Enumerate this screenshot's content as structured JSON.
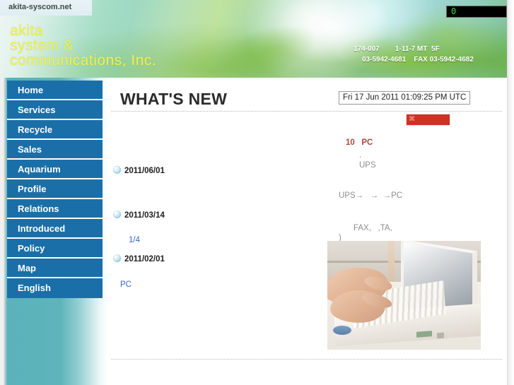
{
  "header": {
    "site_url": "akita-syscom.net",
    "logo_line1": "akita",
    "logo_line2": "system &",
    "logo_line3": "communications, Inc.",
    "counter_value": "0",
    "contact_line1": "174-007        1-11-7 MT  5F",
    "contact_line2": "03-5942-4681    FAX 03-5942-4682",
    "counter_icon": "hit-counter"
  },
  "sidebar": {
    "items": [
      {
        "label": "Home"
      },
      {
        "label": "Services"
      },
      {
        "label": "Recycle"
      },
      {
        "label": "Sales"
      },
      {
        "label": "Aquarium"
      },
      {
        "label": "Profile"
      },
      {
        "label": "Relations"
      },
      {
        "label": "Introduced"
      },
      {
        "label": "Policy"
      },
      {
        "label": "Map"
      },
      {
        "label": "English"
      }
    ]
  },
  "main": {
    "page_title": "WHAT'S NEW",
    "datetime": "Fri 17 Jun 2011 01:09:25 PM UTC",
    "banner": {
      "glyph": "⌘",
      "color": "#cf3125"
    },
    "news": [
      {
        "date": "2011/06/01"
      },
      {
        "date": "2011/03/14"
      },
      {
        "date": "2011/02/01"
      }
    ],
    "news_links": [
      {
        "label": "1/4"
      },
      {
        "label": "PC"
      }
    ],
    "right_column": {
      "heading": "10   PC",
      "line1": ".",
      "line2": "UPS",
      "line3": "UPS→   →  →PC",
      "line4": "FAX,   ,TA,",
      "line5": ")"
    },
    "photo_alt": "hands-typing-on-laptop"
  },
  "colors": {
    "nav_blue": "#1b6fa8",
    "sidebar_teal": "#5bb2ba",
    "logo_yellow": "#f2f24a",
    "accent_red": "#b1453c",
    "banner_red": "#cf3125",
    "link_blue": "#3366cc",
    "counter_green": "#3cd43c"
  }
}
